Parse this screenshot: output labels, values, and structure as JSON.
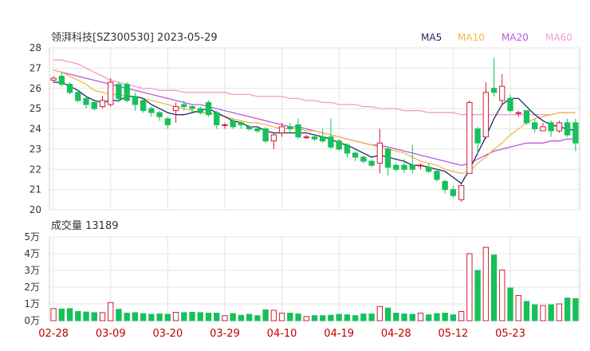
{
  "header": {
    "title": "领湃科技[SZ300530] 2023-05-29",
    "ma_legend": [
      {
        "label": "MA5",
        "color": "#1f2a6b"
      },
      {
        "label": "MA10",
        "color": "#f3b74a"
      },
      {
        "label": "MA20",
        "color": "#b85bd6"
      },
      {
        "label": "MA60",
        "color": "#f29bd2"
      }
    ]
  },
  "volume_panel": {
    "label": "成交量 13189"
  },
  "colors": {
    "up": "#d41c3a",
    "down": "#16c05a",
    "grid": "#e4e4e4"
  },
  "chart_data": [
    {
      "type": "candlestick",
      "ylim": [
        20,
        28
      ],
      "yticks": [
        "20",
        "21",
        "22",
        "23",
        "24",
        "25",
        "26",
        "27",
        "28"
      ],
      "xticks": [
        "02-28",
        "03-09",
        "03-20",
        "03-29",
        "04-10",
        "04-19",
        "04-28",
        "05-12",
        "05-23"
      ],
      "xtick_index": [
        0,
        7,
        14,
        21,
        28,
        35,
        42,
        49,
        56
      ],
      "series": [
        {
          "name": "K",
          "candles": [
            [
              26.4,
              26.5,
              26.6,
              26.3
            ],
            [
              26.6,
              26.2,
              26.8,
              26.1
            ],
            [
              26.2,
              25.8,
              26.3,
              25.7
            ],
            [
              25.8,
              25.4,
              25.9,
              25.3
            ],
            [
              25.5,
              25.2,
              25.6,
              25.0
            ],
            [
              25.3,
              25.0,
              25.4,
              24.9
            ],
            [
              25.1,
              25.4,
              25.6,
              25.0
            ],
            [
              25.2,
              26.3,
              26.5,
              25.1
            ],
            [
              26.2,
              25.5,
              26.3,
              25.3
            ],
            [
              26.2,
              25.4,
              26.3,
              25.3
            ],
            [
              25.6,
              25.2,
              25.8,
              24.9
            ],
            [
              25.4,
              24.9,
              25.5,
              24.8
            ],
            [
              25.0,
              24.8,
              25.1,
              24.6
            ],
            [
              24.8,
              24.6,
              24.9,
              24.4
            ],
            [
              24.5,
              24.2,
              24.6,
              24.0
            ],
            [
              24.9,
              25.1,
              25.3,
              24.3
            ],
            [
              25.2,
              25.1,
              25.4,
              24.9
            ],
            [
              25.1,
              25.0,
              25.2,
              24.8
            ],
            [
              25.0,
              24.8,
              25.1,
              24.7
            ],
            [
              25.3,
              24.7,
              25.4,
              24.6
            ],
            [
              24.8,
              24.2,
              24.9,
              24.0
            ],
            [
              24.2,
              24.2,
              24.3,
              24.0
            ],
            [
              24.4,
              24.1,
              24.5,
              24.0
            ],
            [
              24.3,
              24.2,
              24.4,
              24.0
            ],
            [
              24.1,
              24.0,
              24.2,
              23.9
            ],
            [
              24.0,
              23.9,
              24.1,
              23.8
            ],
            [
              24.0,
              23.4,
              24.1,
              23.3
            ],
            [
              23.4,
              23.7,
              23.8,
              23.0
            ],
            [
              23.8,
              24.1,
              24.3,
              23.6
            ],
            [
              24.1,
              24.0,
              24.3,
              23.8
            ],
            [
              24.2,
              23.6,
              24.5,
              23.5
            ],
            [
              23.6,
              23.6,
              23.7,
              23.5
            ],
            [
              23.6,
              23.5,
              23.7,
              23.4
            ],
            [
              23.6,
              23.4,
              24.0,
              23.3
            ],
            [
              23.6,
              23.1,
              24.5,
              23.0
            ],
            [
              23.4,
              23.0,
              23.5,
              22.9
            ],
            [
              23.2,
              22.8,
              23.3,
              22.6
            ],
            [
              22.8,
              22.6,
              22.9,
              22.4
            ],
            [
              22.6,
              22.4,
              22.7,
              22.3
            ],
            [
              22.4,
              22.2,
              22.5,
              22.1
            ],
            [
              22.3,
              23.3,
              24.0,
              21.8
            ],
            [
              23.0,
              22.1,
              23.1,
              21.7
            ],
            [
              22.2,
              22.0,
              22.3,
              21.9
            ],
            [
              22.2,
              22.0,
              22.5,
              21.8
            ],
            [
              22.2,
              22.0,
              23.2,
              21.8
            ],
            [
              22.2,
              22.2,
              22.3,
              22.0
            ],
            [
              22.1,
              21.9,
              22.3,
              21.8
            ],
            [
              21.9,
              21.5,
              22.0,
              21.4
            ],
            [
              21.4,
              21.0,
              21.5,
              20.8
            ],
            [
              21.0,
              20.7,
              21.2,
              20.6
            ],
            [
              20.5,
              21.2,
              21.3,
              20.4
            ],
            [
              21.8,
              25.3,
              25.4,
              21.8
            ],
            [
              24.0,
              23.3,
              24.1,
              22.7
            ],
            [
              23.6,
              25.8,
              26.3,
              23.5
            ],
            [
              26.0,
              25.8,
              27.5,
              25.6
            ],
            [
              25.4,
              26.1,
              26.7,
              25.2
            ],
            [
              25.5,
              24.9,
              25.7,
              24.8
            ],
            [
              24.8,
              24.8,
              24.9,
              24.6
            ],
            [
              24.9,
              24.3,
              24.9,
              24.2
            ],
            [
              24.3,
              24.0,
              24.5,
              23.8
            ],
            [
              23.9,
              24.1,
              24.3,
              23.9
            ],
            [
              24.3,
              23.9,
              24.4,
              23.6
            ],
            [
              23.9,
              24.3,
              24.4,
              23.8
            ],
            [
              24.3,
              23.7,
              24.5,
              23.6
            ],
            [
              24.3,
              23.3,
              24.5,
              22.9
            ]
          ]
        },
        {
          "name": "MA5",
          "values": [
            26.3,
            26.3,
            26.1,
            25.9,
            25.6,
            25.4,
            25.3,
            25.4,
            25.4,
            25.6,
            25.6,
            25.5,
            25.2,
            25.0,
            24.8,
            24.7,
            24.7,
            24.8,
            24.9,
            25.0,
            24.8,
            24.6,
            24.4,
            24.3,
            24.1,
            24.1,
            23.9,
            23.8,
            23.8,
            23.8,
            23.8,
            23.8,
            23.7,
            23.6,
            23.5,
            23.3,
            23.2,
            23.0,
            22.8,
            22.6,
            22.7,
            22.6,
            22.5,
            22.4,
            22.2,
            22.2,
            22.1,
            22.0,
            21.9,
            21.6,
            21.3,
            22.0,
            22.8,
            23.6,
            24.5,
            25.2,
            25.5,
            25.5,
            25.1,
            24.7,
            24.4,
            24.2,
            24.1,
            24.0,
            23.9
          ]
        },
        {
          "name": "MA10",
          "values": [
            26.9,
            26.8,
            26.6,
            26.4,
            26.2,
            25.9,
            25.8,
            25.7,
            25.7,
            25.6,
            25.6,
            25.5,
            25.4,
            25.3,
            25.2,
            25.1,
            25.0,
            24.9,
            24.8,
            24.8,
            24.7,
            24.6,
            24.5,
            24.4,
            24.3,
            24.3,
            24.2,
            24.1,
            24.0,
            24.0,
            24.0,
            23.9,
            23.9,
            23.8,
            23.7,
            23.6,
            23.5,
            23.4,
            23.3,
            23.2,
            23.1,
            23.0,
            22.9,
            22.8,
            22.6,
            22.4,
            22.3,
            22.2,
            22.0,
            21.9,
            21.8,
            21.9,
            22.3,
            22.6,
            23.0,
            23.3,
            23.7,
            24.0,
            24.3,
            24.5,
            24.6,
            24.7,
            24.8,
            24.8,
            24.8
          ]
        },
        {
          "name": "MA20",
          "values": [
            26.9,
            26.8,
            26.7,
            26.6,
            26.5,
            26.4,
            26.3,
            26.2,
            26.1,
            26.0,
            25.9,
            25.8,
            25.7,
            25.6,
            25.5,
            25.4,
            25.3,
            25.2,
            25.2,
            25.1,
            25.0,
            24.9,
            24.8,
            24.7,
            24.6,
            24.5,
            24.4,
            24.3,
            24.2,
            24.1,
            24.1,
            24.0,
            23.9,
            23.8,
            23.7,
            23.6,
            23.5,
            23.4,
            23.3,
            23.2,
            23.2,
            23.1,
            23.0,
            22.9,
            22.8,
            22.7,
            22.6,
            22.5,
            22.4,
            22.3,
            22.2,
            22.3,
            22.5,
            22.7,
            22.9,
            23.0,
            23.1,
            23.2,
            23.3,
            23.3,
            23.3,
            23.4,
            23.4,
            23.5,
            23.5
          ]
        },
        {
          "name": "MA60",
          "values": [
            27.4,
            27.4,
            27.3,
            27.2,
            27.0,
            26.8,
            26.6,
            26.4,
            26.3,
            26.2,
            26.1,
            26.0,
            26.0,
            25.9,
            25.9,
            25.9,
            25.8,
            25.8,
            25.8,
            25.8,
            25.8,
            25.8,
            25.7,
            25.7,
            25.7,
            25.6,
            25.6,
            25.6,
            25.6,
            25.5,
            25.5,
            25.4,
            25.4,
            25.3,
            25.3,
            25.2,
            25.2,
            25.2,
            25.1,
            25.1,
            25.0,
            25.0,
            25.0,
            24.9,
            24.9,
            24.9,
            24.8,
            24.8,
            24.8,
            24.8,
            24.7,
            24.7,
            24.7,
            24.7,
            24.7,
            24.7,
            24.7,
            24.7,
            24.7,
            24.7,
            24.7,
            24.7,
            24.8,
            24.8,
            24.8
          ]
        }
      ]
    },
    {
      "type": "bar",
      "ylim": [
        0,
        5
      ],
      "yticks": [
        "0万",
        "1万",
        "2万",
        "3万",
        "4万",
        "5万"
      ],
      "series": [
        {
          "name": "成交量",
          "values": [
            0.72,
            0.7,
            0.72,
            0.55,
            0.52,
            0.48,
            0.48,
            1.08,
            0.68,
            0.45,
            0.48,
            0.42,
            0.38,
            0.4,
            0.38,
            0.5,
            0.48,
            0.5,
            0.48,
            0.45,
            0.45,
            0.3,
            0.42,
            0.32,
            0.38,
            0.3,
            0.65,
            0.62,
            0.45,
            0.45,
            0.4,
            0.25,
            0.3,
            0.3,
            0.32,
            0.38,
            0.35,
            0.3,
            0.4,
            0.4,
            0.85,
            0.75,
            0.45,
            0.4,
            0.38,
            0.45,
            0.35,
            0.42,
            0.45,
            0.35,
            0.55,
            4.0,
            3.0,
            4.38,
            3.92,
            3.02,
            1.95,
            1.5,
            1.15,
            0.95,
            0.9,
            0.95,
            1.0,
            1.35,
            1.32
          ]
        }
      ]
    }
  ]
}
